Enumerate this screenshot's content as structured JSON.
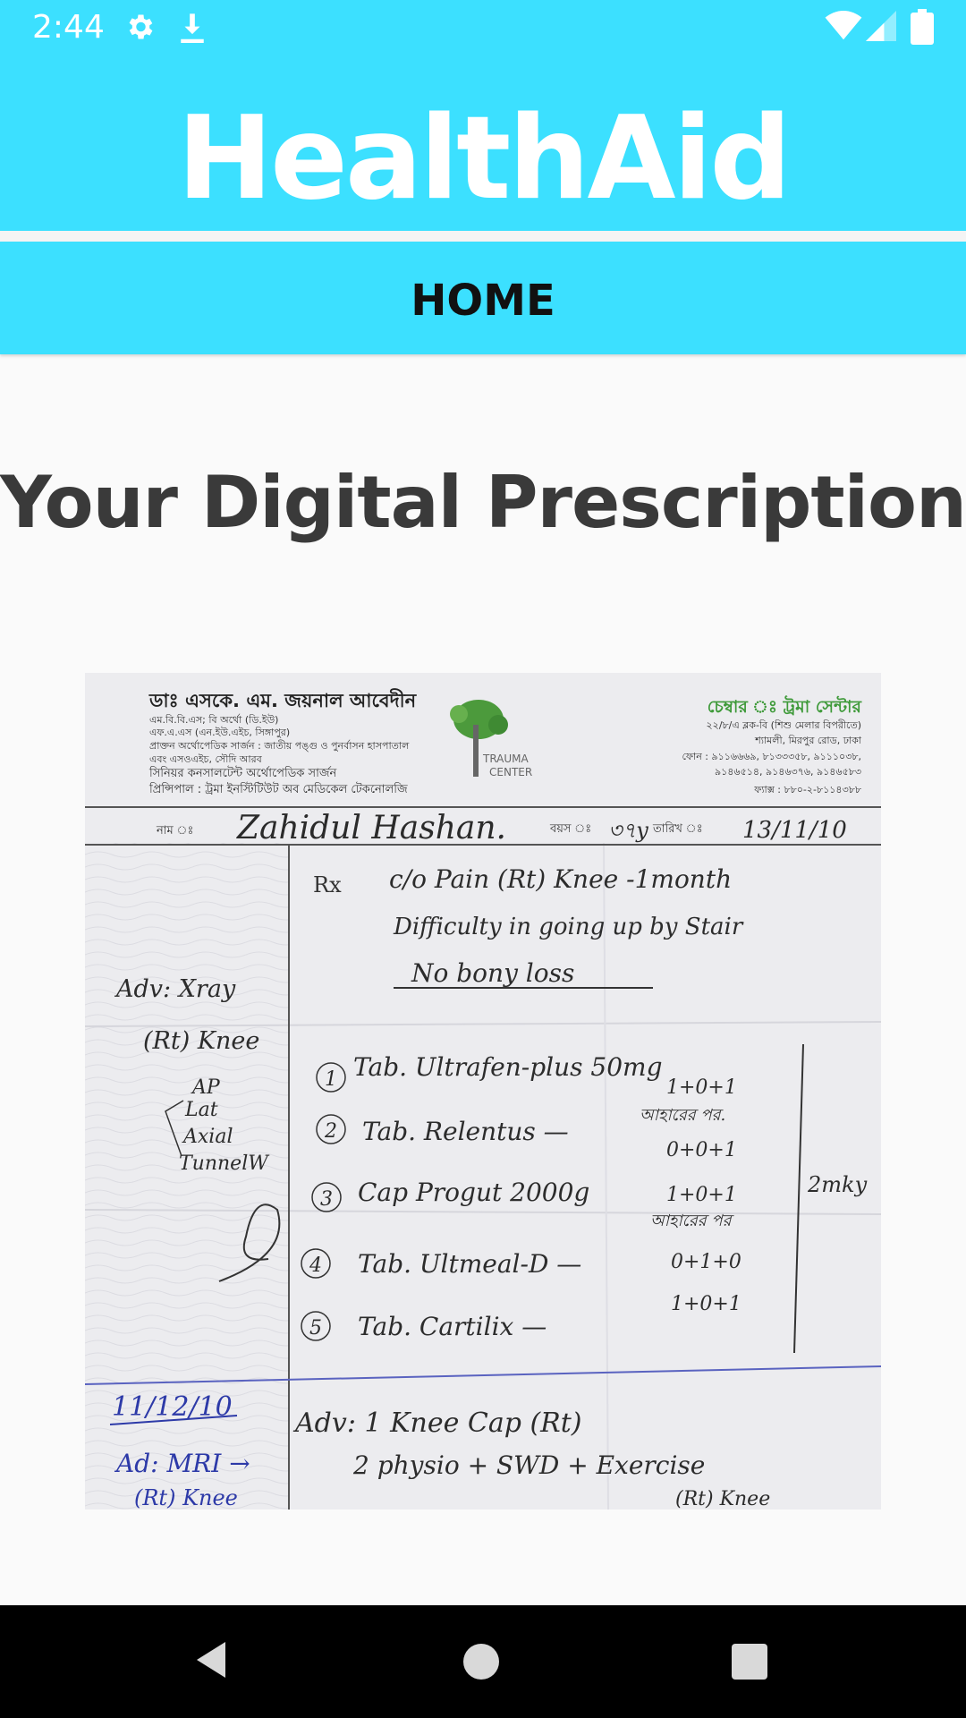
{
  "status_bar": {
    "time": "2:44",
    "icons": [
      "settings-icon",
      "download-icon",
      "wifi-icon",
      "signal-icon",
      "battery-icon"
    ]
  },
  "app": {
    "title": "HealthAid",
    "accent_color": "#3ce0ff"
  },
  "tabs": [
    {
      "label": "HOME"
    }
  ],
  "main": {
    "heading": "Your Digital Prescription",
    "prescription": {
      "doctor_name_bn": "ডাঃ এসকে. এম. জয়নাল আবেদীন",
      "doctor_details_bn": [
        "এম.বি.বি.এস; বি অর্থো (ডি.ইউ)",
        "এফ.এ.এস (এন.ইউ.এইচ, সিঙ্গাপুর)",
        "প্রাক্তন অর্থোপেডিক সার্জন : জাতীয় পঙ্গু ও পুনর্বাসন হাসপাতাল",
        "এবং এসওএইচ, সৌদি আরব",
        "সিনিয়র কনসালটেন্ট অর্থোপেডিক সার্জন",
        "প্রিন্সিপাল : ট্রমা ইনস্টিটিউট অব মেডিকেল টেকনোলজি"
      ],
      "logo_text": [
        "TRAUMA",
        "CENTER"
      ],
      "chamber_bn": "চেম্বার ঃ ট্রমা সেন্টার",
      "chamber_details_bn": [
        "২২/৮/এ ব্লক-বি (শিশু মেলার বিপরীতে)",
        "শ্যামলী, মিরপুর রোড, ঢাকা",
        "ফোন : ৯১১৬৬৬৯, ৮১৩৩৩৫৮, ৯১১১০৩৮,",
        "৯১৪৬৫১৪, ৯১৪৬৩৭৬, ৯১৪৬৫৮৩",
        "ফ্যাক্স : ৮৮০-২-৮১১৪৩৮৮"
      ],
      "name_label_bn": "নাম ঃ",
      "patient_name": "Zahidul Hashan.",
      "age_label_bn": "বয়স ঃ",
      "age": "৩৭y",
      "date_label_bn": "তারিখ ঃ",
      "date": "13/11/10",
      "rx_symbol": "Rx",
      "complaint": [
        "c/o Pain (Rt) Knee -1month",
        "Difficulty in going up by Stair",
        "No bony loss"
      ],
      "advice_left": [
        "Adv: Xray",
        "(Rt) Knee",
        "AP",
        "Lat",
        "Axial",
        "TunnelW"
      ],
      "medicines": [
        {
          "num": "1",
          "name": "Tab. Ultrafen-plus 50mg",
          "dose": "1+0+1",
          "note": "আহারের পর."
        },
        {
          "num": "2",
          "name": "Tab. Relentus —",
          "dose": "0+0+1",
          "note": ""
        },
        {
          "num": "3",
          "name": "Cap Progut 2000g",
          "dose": "1+0+1",
          "note": "আহারের পর"
        },
        {
          "num": "4",
          "name": "Tab. Ultmeal-D —",
          "dose": "0+1+0",
          "note": ""
        },
        {
          "num": "5",
          "name": "Tab. Cartilix —",
          "dose": "1+0+1",
          "note": ""
        }
      ],
      "duration": "2mky",
      "followup_date": "11/12/10",
      "followup_left": [
        "Ad: MRI →",
        "(Rt) Knee"
      ],
      "followup_advice": [
        "Adv: 1 Knee Cap (Rt)",
        "2 physio + SWD + Exercise",
        "(Rt) Knee"
      ]
    }
  },
  "nav_bar": {
    "buttons": [
      "back-icon",
      "home-icon",
      "recents-icon"
    ]
  }
}
